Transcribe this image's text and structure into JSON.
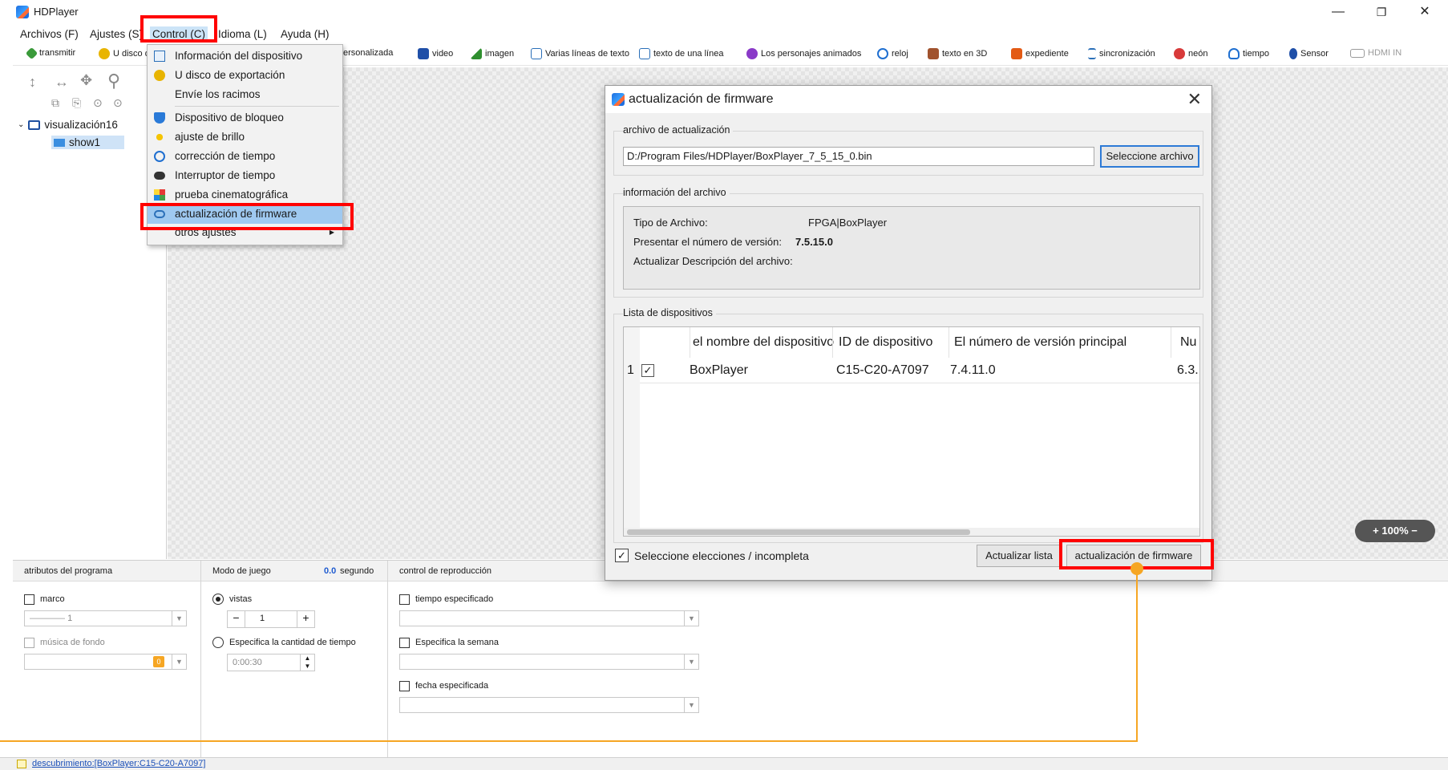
{
  "app": {
    "title": "HDPlayer"
  },
  "window_controls": {
    "minimize": "—",
    "maximize": "❐",
    "close": "✕"
  },
  "menubar": [
    "Archivos (F)",
    "Ajustes (S)",
    "Control (C)",
    "Idioma (L)",
    "Ayuda (H)"
  ],
  "toolbar": [
    {
      "label": "transmitir",
      "icon": "broadcast-icon",
      "color": "#3a9a3a"
    },
    {
      "label": "U disco d",
      "icon": "usb-disk-icon",
      "color": "#e8b400"
    },
    {
      "label": "ersonalizada",
      "icon": "custom-icon",
      "color": "#7a7a7a"
    },
    {
      "label": "video",
      "icon": "video-icon",
      "color": "#1f4fa8"
    },
    {
      "label": "imagen",
      "icon": "image-icon",
      "color": "#2f8f2f"
    },
    {
      "label": "Varias líneas de texto",
      "icon": "multiline-text-icon",
      "color": "#2a6fb8"
    },
    {
      "label": "texto de una línea",
      "icon": "single-line-text-icon",
      "color": "#2a6fb8"
    },
    {
      "label": "Los personajes animados",
      "icon": "animated-text-icon",
      "color": "#8a3ac8"
    },
    {
      "label": "reloj",
      "icon": "clock-icon",
      "color": "#1f6fd0"
    },
    {
      "label": "texto en 3D",
      "icon": "text-3d-icon",
      "color": "#a0522d"
    },
    {
      "label": "expediente",
      "icon": "office-file-icon",
      "color": "#e35a14"
    },
    {
      "label": "sincronización",
      "icon": "hourglass-icon",
      "color": "#2a6fb8"
    },
    {
      "label": "neón",
      "icon": "neon-icon",
      "color": "#d83a3a"
    },
    {
      "label": "tiempo",
      "icon": "weather-icon",
      "color": "#1f6fd0"
    },
    {
      "label": "Sensor",
      "icon": "sensor-icon",
      "color": "#1f4fa8"
    },
    {
      "label": "HDMI IN",
      "icon": "hdmi-icon",
      "color": "#9a9a9a"
    }
  ],
  "tree": {
    "root": "visualización16",
    "child": "show1"
  },
  "dropdown": {
    "items": [
      {
        "label": "Información del dispositivo",
        "icon": "device-info-icon"
      },
      {
        "label": "U disco de exportación",
        "icon": "usb-export-icon"
      },
      {
        "label": "Envíe los racimos",
        "icon": ""
      },
      {
        "label": "Dispositivo de bloqueo",
        "icon": "shield-icon"
      },
      {
        "label": "ajuste de brillo",
        "icon": "brightness-icon"
      },
      {
        "label": "corrección de tiempo",
        "icon": "clock-icon"
      },
      {
        "label": "Interruptor de tiempo",
        "icon": "toggle-icon"
      },
      {
        "label": "prueba cinematográfica",
        "icon": "test-pattern-icon"
      },
      {
        "label": "actualización de firmware",
        "icon": "cloud-upload-icon"
      },
      {
        "label": "otros ajustes",
        "icon": ""
      }
    ]
  },
  "dialog": {
    "title": "actualización de firmware",
    "close": "✕",
    "update_file": {
      "group_title": "archivo de actualización",
      "path": "D:/Program Files/HDPlayer/BoxPlayer_7_5_15_0.bin",
      "select_button": "Seleccione archivo"
    },
    "file_info": {
      "group_title": "información del archivo",
      "type_label": "Tipo de Archivo:",
      "type_value": "FPGA|BoxPlayer",
      "version_label": "Presentar el número de versión:",
      "version_value": "7.5.15.0",
      "desc_label": "Actualizar Descripción del archivo:"
    },
    "devices": {
      "group_title": "Lista de dispositivos",
      "columns": [
        "el nombre del dispositivo",
        "ID de dispositivo",
        "El número de versión principal",
        "Nu"
      ],
      "rows": [
        {
          "index": "1",
          "checked": true,
          "name": "BoxPlayer",
          "id": "C15-C20-A7097",
          "version": "7.4.11.0",
          "extra": "6.3."
        }
      ]
    },
    "select_all": "Seleccione elecciones / incompleta",
    "refresh_button": "Actualizar lista",
    "upgrade_button": "actualización de firmware"
  },
  "bottom": {
    "program_attrs": {
      "title": "atributos del programa",
      "frame": "marco",
      "frame_value": "1",
      "music": "música de fondo",
      "music_value": "0"
    },
    "play_mode": {
      "title": "Modo de juego",
      "duration_value": "0.0",
      "duration_unit": "segundo",
      "views": "vistas",
      "views_value": "1",
      "specify_time": "Especifica la cantidad de tiempo",
      "time_value": "0:00:30",
      "minus": "−",
      "plus": "+"
    },
    "playback": {
      "title": "control de reproducción",
      "specified_time": "tiempo especificado",
      "week": "Especifica la semana",
      "date": "fecha especificada"
    }
  },
  "zoom_pill": "+ 100% −",
  "statusbar": "descubrimiento:[BoxPlayer:C15-C20-A7097]",
  "colors": {
    "highlight_red": "#ff0000",
    "connector_orange": "#f6a623",
    "menu_highlight": "#9fc9f0",
    "focus_blue": "#2d7ad6"
  }
}
